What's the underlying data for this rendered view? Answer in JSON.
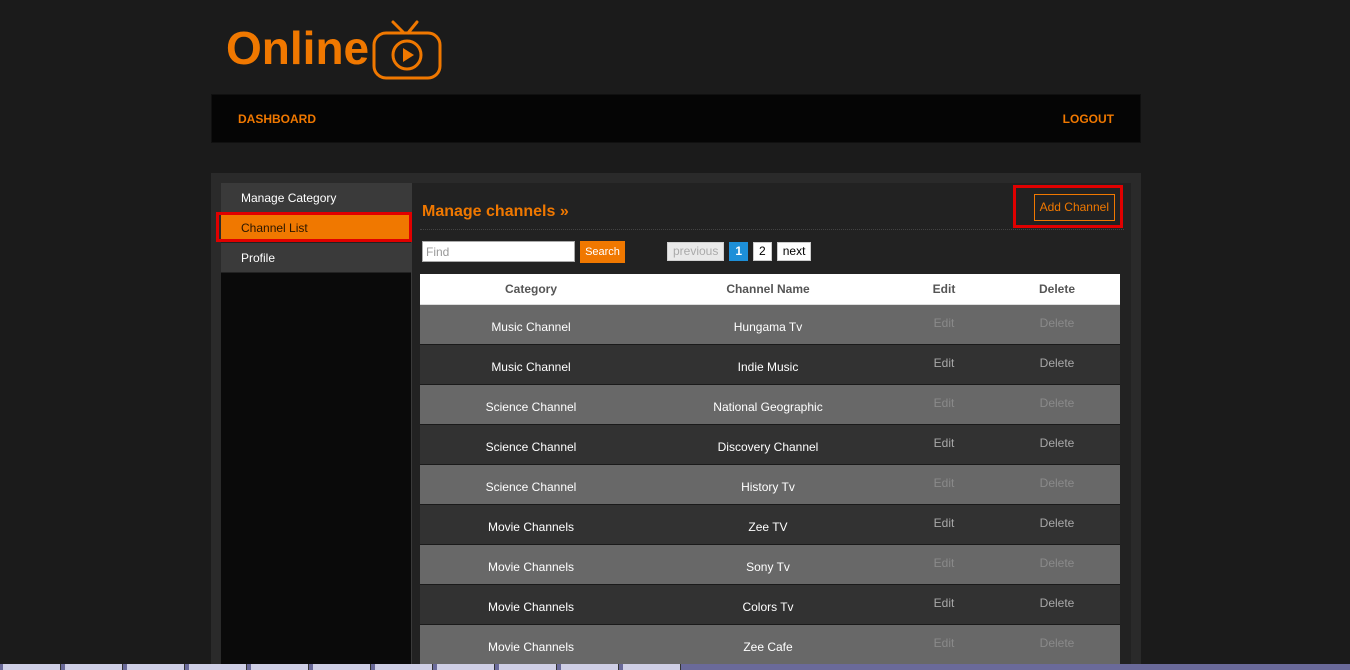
{
  "logo": {
    "text": "Online",
    "icon": "tv-play-icon",
    "color": "#f07800"
  },
  "topnav": {
    "dashboard": "DASHBOARD",
    "logout": "LOGOUT"
  },
  "sidebar": {
    "items": [
      {
        "label": "Manage Category",
        "active": false
      },
      {
        "label": "Channel List",
        "active": true
      },
      {
        "label": "Profile",
        "active": false
      }
    ]
  },
  "main": {
    "title": "Manage channels »",
    "add_button": "Add Channel",
    "search": {
      "placeholder": "Find",
      "value": "",
      "button": "Search"
    },
    "pager": {
      "previous": "previous",
      "pages": [
        "1",
        "2"
      ],
      "current": "1",
      "next": "next"
    },
    "table": {
      "headers": {
        "category": "Category",
        "name": "Channel Name",
        "edit": "Edit",
        "delete": "Delete"
      },
      "rows": [
        {
          "category": "Music Channel",
          "name": "Hungama Tv",
          "edit": "Edit",
          "delete": "Delete"
        },
        {
          "category": "Music Channel",
          "name": "Indie Music",
          "edit": "Edit",
          "delete": "Delete"
        },
        {
          "category": "Science Channel",
          "name": "National Geographic",
          "edit": "Edit",
          "delete": "Delete"
        },
        {
          "category": "Science Channel",
          "name": "Discovery Channel",
          "edit": "Edit",
          "delete": "Delete"
        },
        {
          "category": "Science Channel",
          "name": "History Tv",
          "edit": "Edit",
          "delete": "Delete"
        },
        {
          "category": "Movie Channels",
          "name": "Zee TV",
          "edit": "Edit",
          "delete": "Delete"
        },
        {
          "category": "Movie Channels",
          "name": "Sony Tv",
          "edit": "Edit",
          "delete": "Delete"
        },
        {
          "category": "Movie Channels",
          "name": "Colors Tv",
          "edit": "Edit",
          "delete": "Delete"
        },
        {
          "category": "Movie Channels",
          "name": "Zee Cafe",
          "edit": "Edit",
          "delete": "Delete"
        }
      ]
    }
  },
  "colors": {
    "accent": "#f07800",
    "highlight_box": "#e00000",
    "pager_current": "#1d8fd8"
  }
}
